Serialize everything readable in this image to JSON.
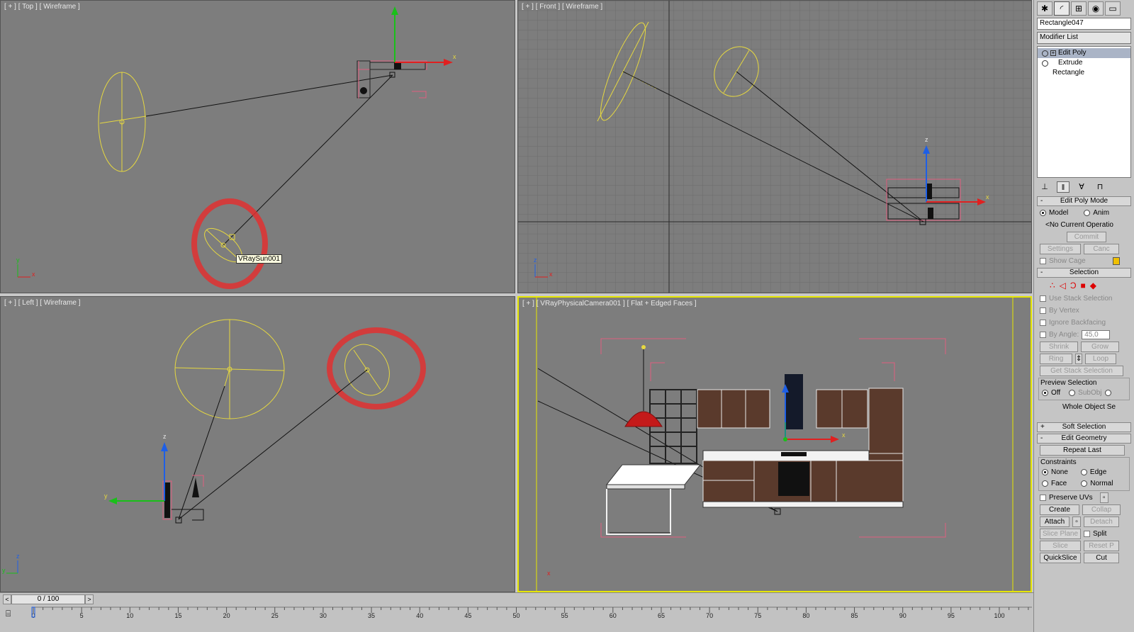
{
  "viewports": {
    "top": {
      "label": "[ + ] [ Top ] [ Wireframe ]",
      "tooltip": "VRaySun001"
    },
    "front": {
      "label": "[ + ] [ Front ] [ Wireframe ]"
    },
    "left": {
      "label": "[ + ] [ Left ] [ Wireframe ]"
    },
    "camera": {
      "label": "[ + ] [ VRayPhysicalCamera001 ] [ Flat + Edged Faces ]"
    }
  },
  "axis_letters": {
    "x": "x",
    "y": "y",
    "z": "z"
  },
  "command_panel": {
    "tab_icons": [
      "create-icon",
      "modify-icon",
      "hierarchy-icon",
      "motion-icon",
      "display-icon"
    ],
    "object_name": "Rectangle047",
    "modifier_list": "Modifier List",
    "stack": [
      {
        "label": "Edit Poly",
        "selected": true
      },
      {
        "label": "Extrude",
        "selected": false
      },
      {
        "label": "Rectangle",
        "selected": false
      }
    ],
    "edit_poly_mode": {
      "title": "Edit Poly Mode",
      "model": "Model",
      "animate": "Anim",
      "no_current_op": "<No Current Operatio",
      "commit": "Commit",
      "settings": "Settings",
      "cancel": "Canc",
      "show_cage": "Show Cage"
    },
    "selection": {
      "title": "Selection",
      "use_stack": "Use Stack Selection",
      "by_vertex": "By Vertex",
      "ignore_backfacing": "Ignore Backfacing",
      "by_angle": "By Angle:",
      "angle_value": "45,0",
      "shrink": "Shrink",
      "grow": "Grow",
      "ring": "Ring",
      "loop": "Loop",
      "get_stack": "Get Stack Selection",
      "preview_title": "Preview Selection",
      "off": "Off",
      "subobj": "SubObj",
      "whole_object": "Whole Object Se"
    },
    "soft_selection": {
      "title": "Soft Selection"
    },
    "edit_geometry": {
      "title": "Edit Geometry",
      "repeat_last": "Repeat Last",
      "constraints": "Constraints",
      "none": "None",
      "edge": "Edge",
      "face": "Face",
      "normal": "Normal",
      "preserve_uvs": "Preserve UVs",
      "create": "Create",
      "collapse": "Collap",
      "attach": "Attach",
      "detach": "Detach",
      "slice_plane": "Slice Plane",
      "split": "Split",
      "slice": "Slice",
      "reset_plane": "Reset P",
      "quickslice": "QuickSlice",
      "cut": "Cut"
    }
  },
  "timeline": {
    "slider_label": "0 / 100",
    "ticks": [
      0,
      5,
      10,
      15,
      20,
      25,
      30,
      35,
      40,
      45,
      50,
      55,
      60,
      65,
      70,
      75,
      80,
      85,
      90,
      95,
      100
    ]
  }
}
